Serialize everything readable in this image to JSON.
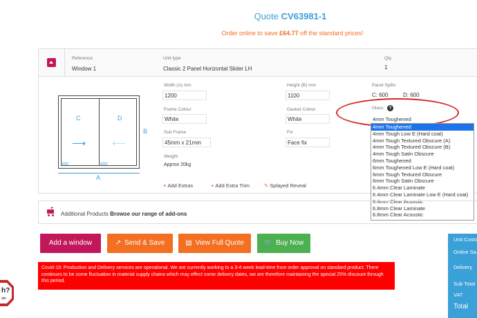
{
  "header": {
    "quote_prefix": "Quote",
    "quote_number": "CV63981-1",
    "promo_before": "Order online to save",
    "promo_amount": "£64.77",
    "promo_after": "off the standard prices!"
  },
  "item": {
    "reference_label": "Reference",
    "reference_value": "Window 1",
    "unit_type_label": "Unit type",
    "unit_type_value": "Classic 2 Panel Horizontal Slider LH",
    "qty_label": "Qty",
    "qty_value": "1"
  },
  "drawing": {
    "pane_left": "C",
    "pane_right": "D",
    "dim_left": "600",
    "dim_right": "600",
    "width_letter": "A",
    "height_letter": "B"
  },
  "fields": {
    "width_label": "Width (A) mm",
    "width_value": "1200",
    "height_label": "Height (B) mm",
    "height_value": "1100",
    "splits_label": "Panel Splits",
    "split_c": "C:  600",
    "split_d": "D:  600",
    "frame_colour_label": "Frame Colour",
    "frame_colour_value": "White",
    "gasket_colour_label": "Gasket Colour",
    "gasket_colour_value": "White",
    "sub_frame_label": "Sub Frame",
    "sub_frame_value": "45mm x 21mm",
    "fix_label": "Fix",
    "fix_value": "Face fix",
    "weight_label": "Weight",
    "weight_value": "Approx 20kg",
    "glass_label": "Glass",
    "glass_value": "4mm Toughened"
  },
  "glass_options": [
    "4mm Toughened",
    "4mm Tough Low E (Hard coat)",
    "4mm Tough Textured Obscure (A)",
    "4mm Tough Textured Obscure (B)",
    "4mm Tough Satin Obscure",
    "6mm Toughened",
    "6mm Toughened Low E (Hard coat)",
    "6mm Tough Textured Obscure",
    "6mm Tough Satin Obscure",
    "6.4mm Clear Laminate",
    "6.4mm Clear Laminate Low E (Hard coat)",
    "6.4mm Clear Acoustic",
    "6.8mm Clear Laminate",
    "6.8mm Clear Acoustic"
  ],
  "extras": {
    "add_extras": "Add Extras",
    "add_extra_trim": "Add Extra Trim",
    "splayed_reveal": "Splayed Reveal"
  },
  "addons": {
    "prefix": "Additional Products",
    "link": "Browse our range of add-ons"
  },
  "buttons": {
    "add_window": "Add a window",
    "send_save": "Send & Save",
    "view_full_quote": "View Full Quote",
    "buy_now": "Buy Now"
  },
  "notice": "Covid-19: Production and Delivery services are operational. We are currently working to a 3-4 week lead-time from order approval on standard product. There continues to be some fluctuation in material supply chains which may effect some delivery dates, we are therefore maintaining the special 25% discount through this period.",
  "summary": {
    "unit_costs": "Unit Costs",
    "online_saving": "Online Sa",
    "delivery": "Delivery",
    "sub_total": "Sub Total",
    "vat": "VAT",
    "total": "Total"
  },
  "badge": {
    "text": "h?",
    "sub": "der"
  },
  "colors": {
    "accent_blue": "#3aa0d8",
    "promo_orange": "#f36f21",
    "brand_magenta": "#c2185b",
    "buy_green": "#4caf50",
    "notice_red": "#ff0000",
    "highlight_red": "#d62728"
  }
}
